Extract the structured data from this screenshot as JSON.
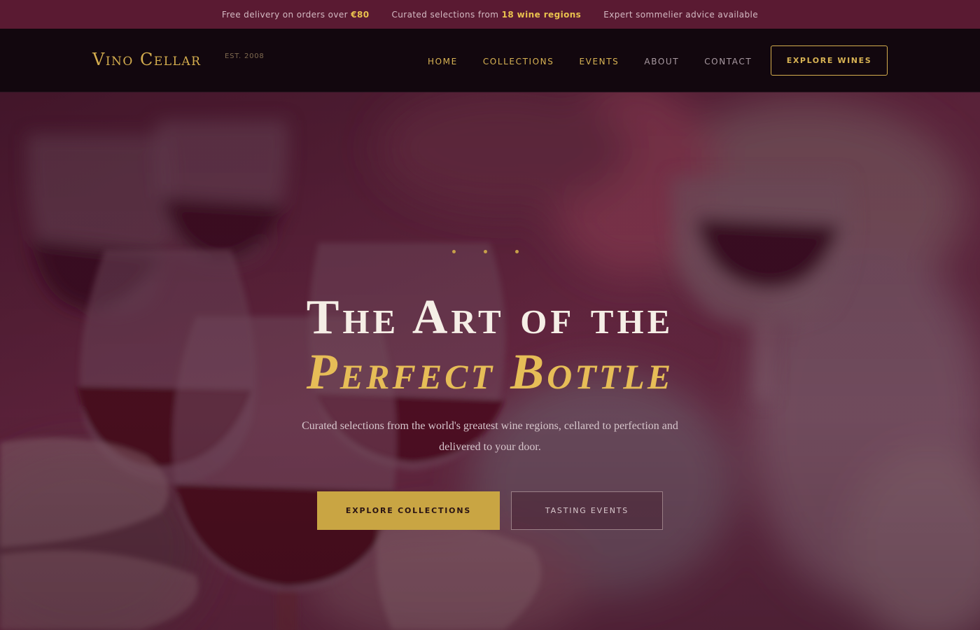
{
  "topbar": {
    "items": [
      {
        "prefix": "Free delivery on orders over ",
        "highlight": "€80"
      },
      {
        "prefix": "Curated selections from ",
        "highlight": "18 wine regions"
      },
      {
        "prefix": "Expert sommelier advice available",
        "highlight": ""
      }
    ]
  },
  "nav": {
    "logo": "Vino Cellar",
    "est": "EST. 2008",
    "links": [
      "HOME",
      "COLLECTIONS",
      "EVENTS",
      "ABOUT",
      "CONTACT"
    ],
    "cta": "EXPLORE WINES"
  },
  "hero": {
    "title_line1": "The Art of the",
    "title_line2": "Perfect Bottle",
    "subtitle": "Curated selections from the world's greatest wine regions, cellared to perfection and delivered to your door.",
    "primary_button": "EXPLORE COLLECTIONS",
    "secondary_button": "TASTING EVENTS"
  },
  "colors": {
    "topbar_bg": "#5a1a32",
    "navbar_bg": "#12070e",
    "gold_accent": "#d4ad4e",
    "button_gold": "#c9a543"
  }
}
